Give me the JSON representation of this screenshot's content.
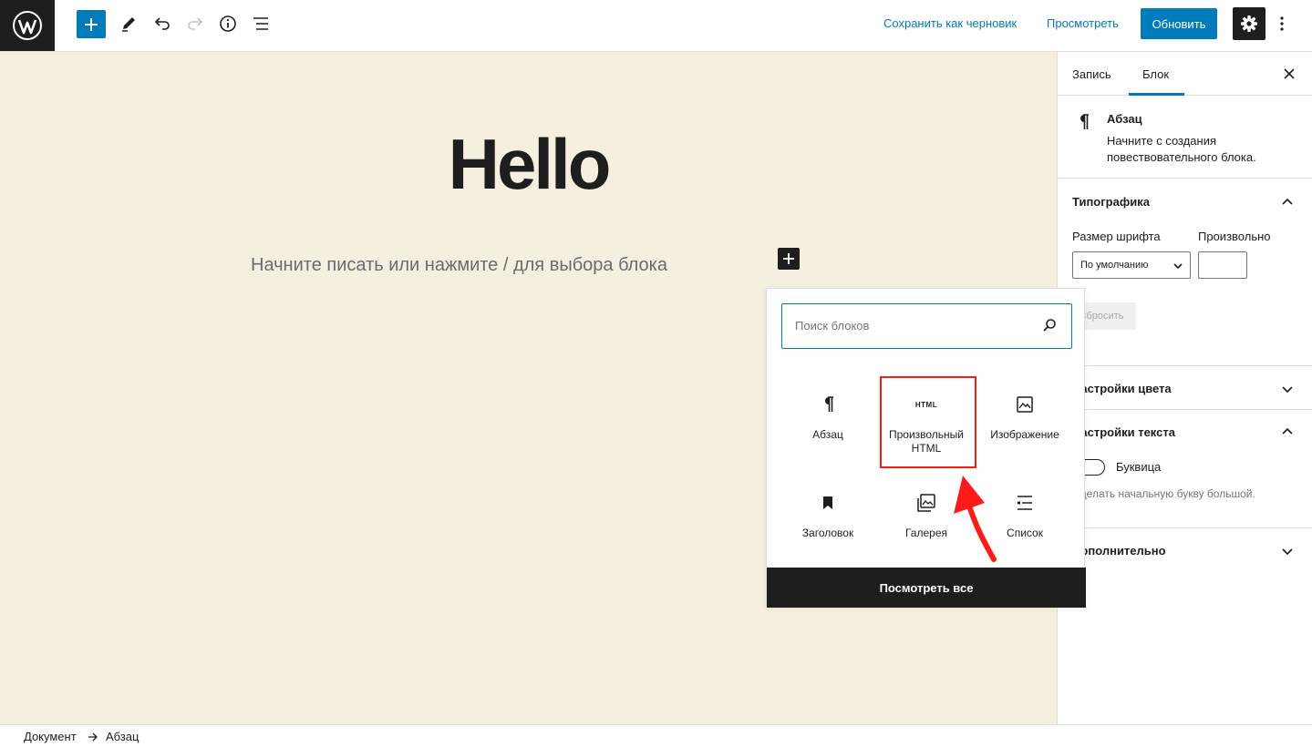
{
  "toolbar": {
    "save_draft": "Сохранить как черновик",
    "preview": "Просмотреть",
    "update": "Обновить"
  },
  "editor": {
    "title": "Hello",
    "placeholder": "Начните писать или нажмите / для выбора блока"
  },
  "inserter": {
    "search_placeholder": "Поиск блоков",
    "blocks": [
      {
        "label": "Абзац",
        "icon": "paragraph-icon"
      },
      {
        "label": "Произвольный HTML",
        "icon": "html-icon",
        "icon_text": "HTML",
        "highlighted": true
      },
      {
        "label": "Изображение",
        "icon": "image-icon"
      },
      {
        "label": "Заголовок",
        "icon": "bookmark-icon"
      },
      {
        "label": "Галерея",
        "icon": "gallery-icon"
      },
      {
        "label": "Список",
        "icon": "list-icon"
      }
    ],
    "view_all": "Посмотреть все"
  },
  "sidebar": {
    "tabs": [
      "Запись",
      "Блок"
    ],
    "active_tab": "Блок",
    "block_card": {
      "title": "Абзац",
      "description": "Начните с создания повествовательного блока."
    },
    "typography": {
      "title": "Типографика",
      "font_size_label": "Размер шрифта",
      "custom_label": "Произвольно",
      "font_size_value": "По умолчанию",
      "reset": "Сбросить"
    },
    "color_settings": {
      "title": "Настройки цвета"
    },
    "text_settings": {
      "title": "Настройки текста",
      "drop_cap_label": "Буквица",
      "drop_cap_help": "Сделать начальную букву большой."
    },
    "advanced": {
      "title": "Дополнительно"
    }
  },
  "breadcrumb": [
    "Документ",
    "Абзац"
  ],
  "colors": {
    "accent": "#007cba",
    "canvas_bg": "#f5efe0",
    "dark": "#1e1e1e",
    "annotation": "#ff1a1a"
  }
}
